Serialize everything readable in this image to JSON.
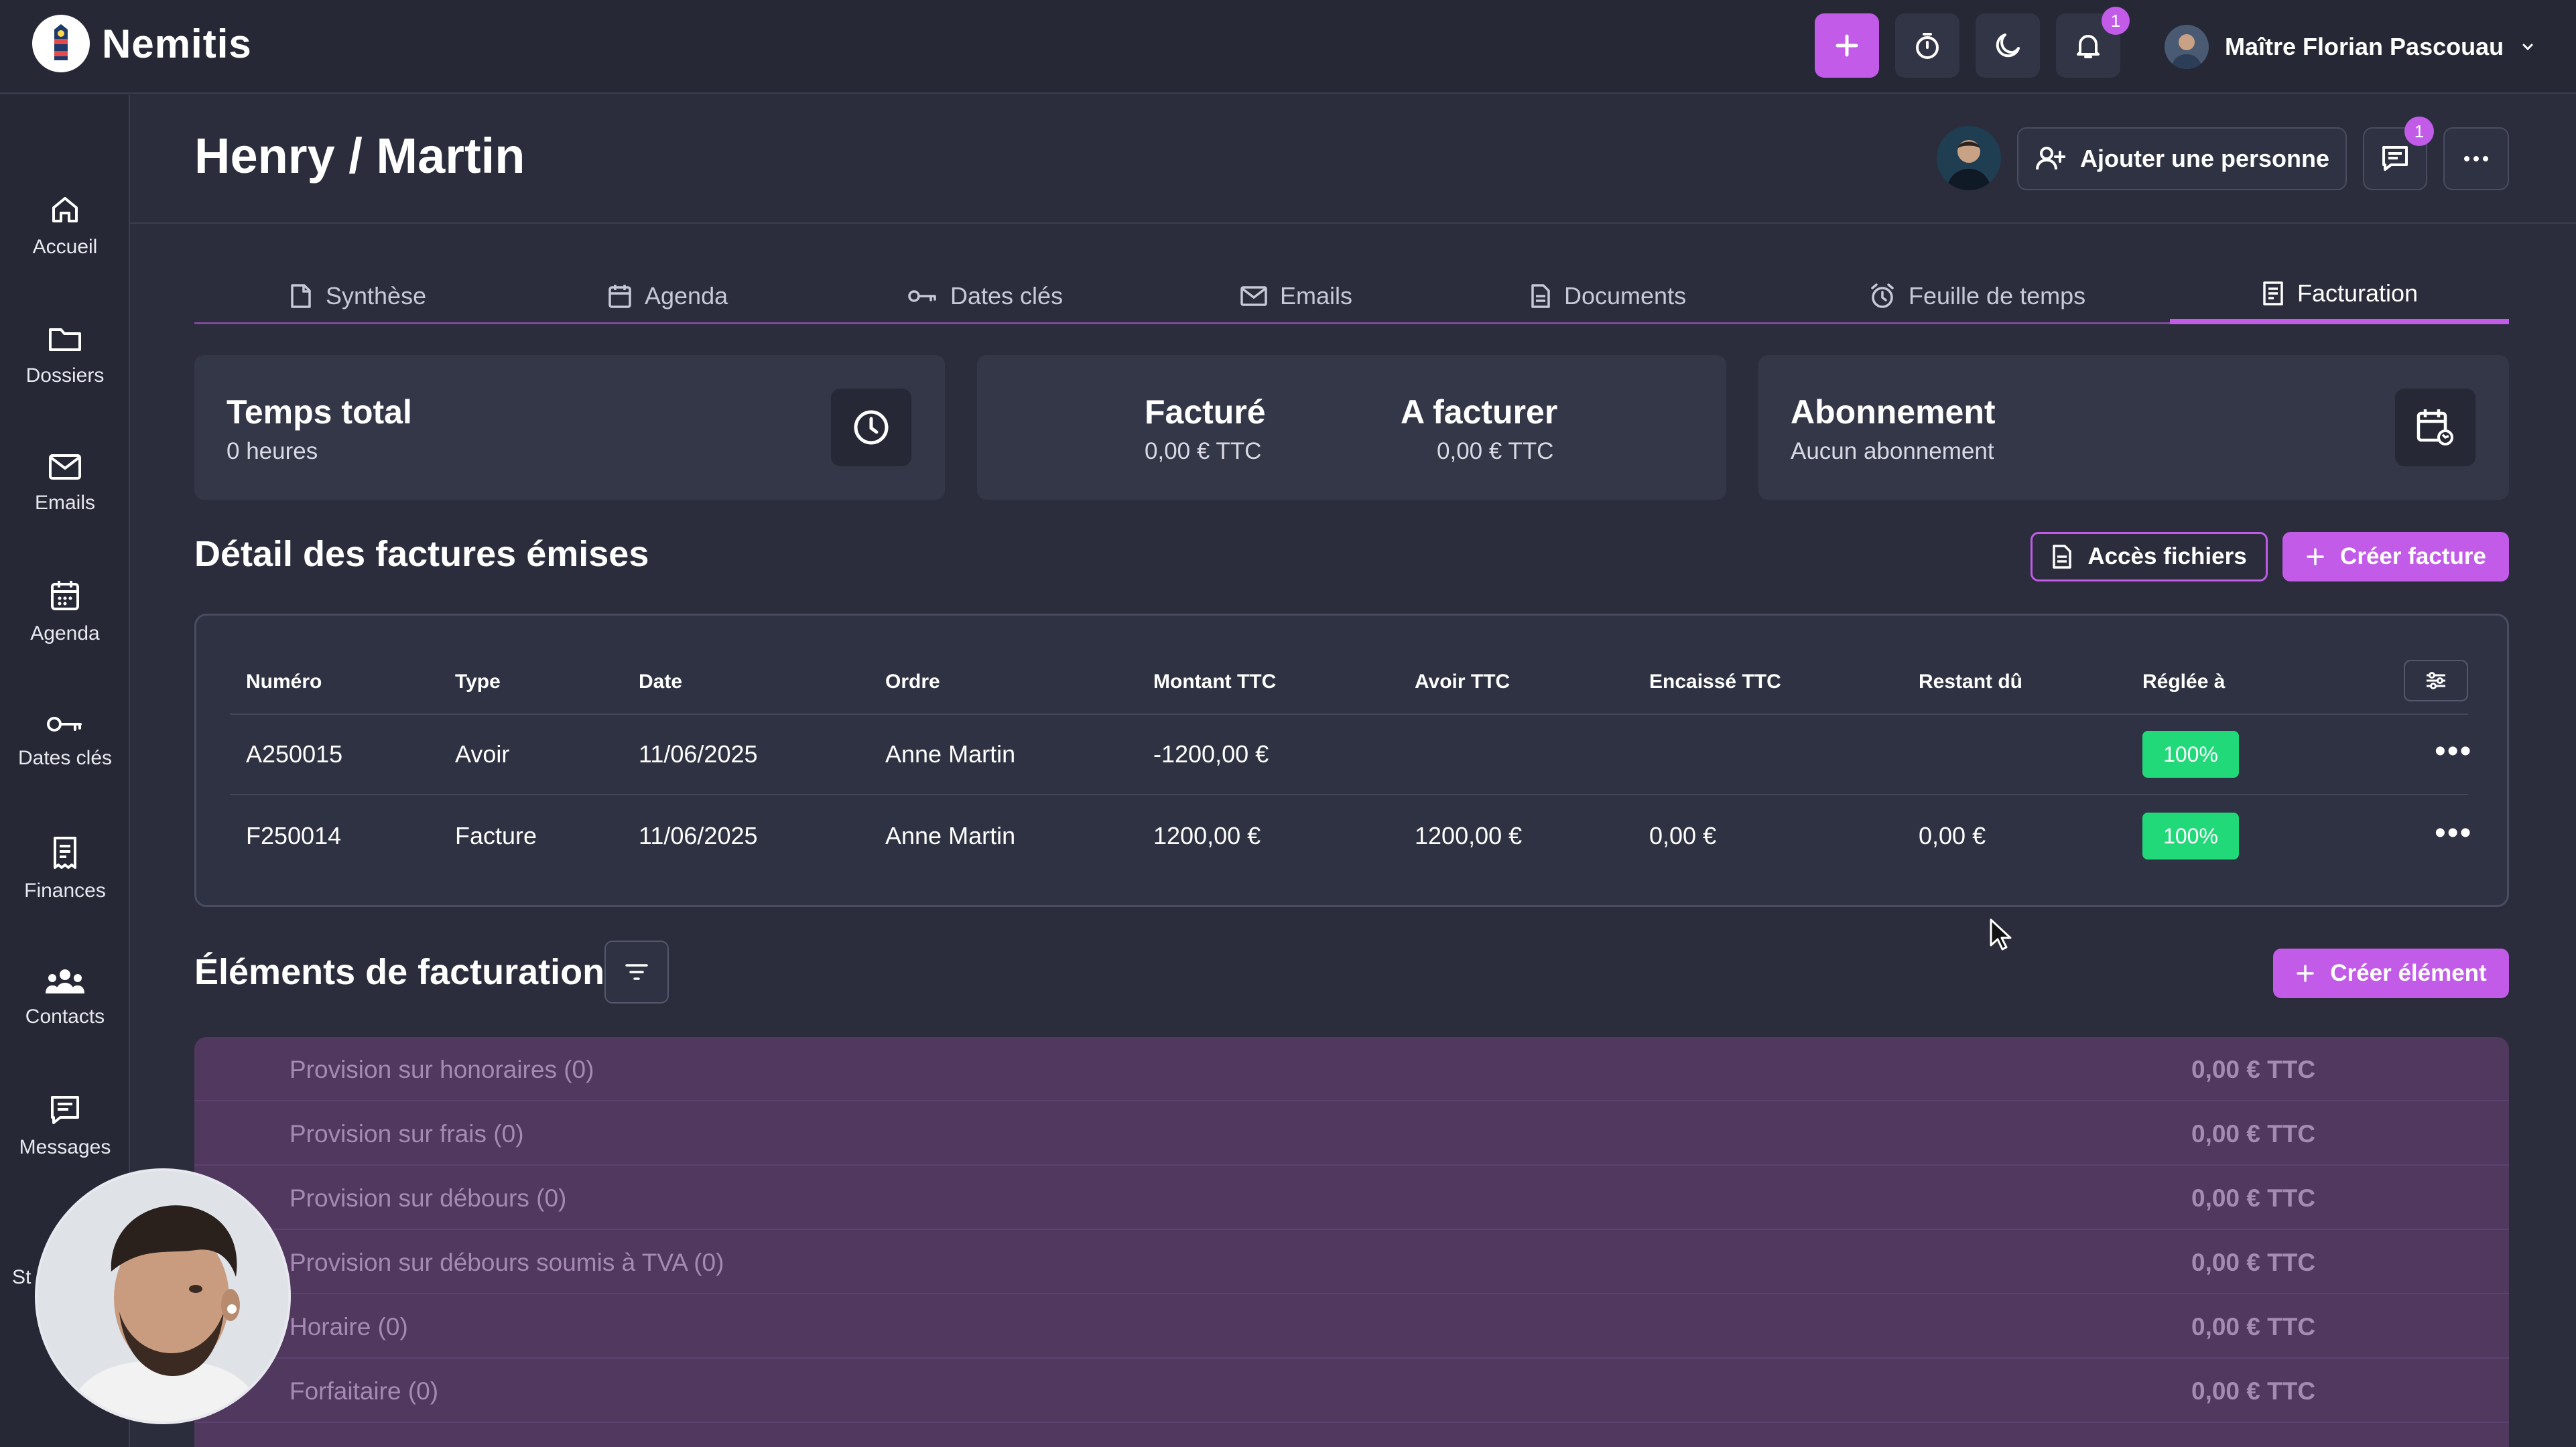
{
  "app": {
    "name": "Nemitis"
  },
  "topbar": {
    "notification_count": "1",
    "user_name": "Maître Florian Pascouau",
    "icons": [
      "plus-icon",
      "stopwatch-icon",
      "moon-icon",
      "bell-icon",
      "chevron-down-icon"
    ]
  },
  "sidebar": {
    "items": [
      {
        "label": "Accueil",
        "icon": "home-icon"
      },
      {
        "label": "Dossiers",
        "icon": "folder-icon"
      },
      {
        "label": "Emails",
        "icon": "mail-icon"
      },
      {
        "label": "Agenda",
        "icon": "calendar-icon"
      },
      {
        "label": "Dates clés",
        "icon": "key-icon"
      },
      {
        "label": "Finances",
        "icon": "receipt-icon"
      },
      {
        "label": "Contacts",
        "icon": "users-icon"
      },
      {
        "label": "Messages",
        "icon": "message-icon"
      }
    ],
    "partial_label": "St"
  },
  "header": {
    "title": "Henry / Martin",
    "add_person_label": "Ajouter une personne",
    "messages_badge": "1"
  },
  "tabs": [
    {
      "label": "Synthèse",
      "icon": "document-icon",
      "active": false
    },
    {
      "label": "Agenda",
      "icon": "calendar-icon",
      "active": false
    },
    {
      "label": "Dates clés",
      "icon": "key-icon",
      "active": false
    },
    {
      "label": "Emails",
      "icon": "mail-icon",
      "active": false
    },
    {
      "label": "Documents",
      "icon": "file-icon",
      "active": false
    },
    {
      "label": "Feuille de temps",
      "icon": "alarm-icon",
      "active": false
    },
    {
      "label": "Facturation",
      "icon": "invoice-icon",
      "active": true
    }
  ],
  "summary": {
    "time": {
      "title": "Temps total",
      "value": "0 heures"
    },
    "billed": {
      "title": "Facturé",
      "value": "0,00 € TTC"
    },
    "to_bill": {
      "title": "A facturer",
      "value": "0,00 € TTC"
    },
    "subscription": {
      "title": "Abonnement",
      "value": "Aucun abonnement"
    }
  },
  "invoices": {
    "title": "Détail des factures émises",
    "files_button": "Accès fichiers",
    "create_button": "Créer facture",
    "columns": [
      "Numéro",
      "Type",
      "Date",
      "Ordre",
      "Montant TTC",
      "Avoir TTC",
      "Encaissé TTC",
      "Restant dû",
      "Réglée à"
    ],
    "rows": [
      {
        "numero": "A250015",
        "type": "Avoir",
        "date": "11/06/2025",
        "ordre": "Anne Martin",
        "montant": "-1200,00 €",
        "avoir": "",
        "encaisse": "",
        "restant": "",
        "reglee": "100%",
        "menu": "•••"
      },
      {
        "numero": "F250014",
        "type": "Facture",
        "date": "11/06/2025",
        "ordre": "Anne Martin",
        "montant": "1200,00 €",
        "avoir": "1200,00 €",
        "encaisse": "0,00 €",
        "restant": "0,00 €",
        "reglee": "100%",
        "menu": "•••"
      }
    ]
  },
  "elements": {
    "title": "Éléments de facturation",
    "create_button": "Créer élément",
    "rows": [
      {
        "label": "Provision sur honoraires (0)",
        "amount": "0,00 € TTC"
      },
      {
        "label": "Provision sur frais (0)",
        "amount": "0,00 € TTC"
      },
      {
        "label": "Provision sur débours (0)",
        "amount": "0,00 € TTC"
      },
      {
        "label": "Provision sur débours soumis à TVA (0)",
        "amount": "0,00 € TTC"
      },
      {
        "label": "Horaire (0)",
        "amount": "0,00 € TTC"
      },
      {
        "label": "Forfaitaire (0)",
        "amount": "0,00 € TTC"
      }
    ]
  },
  "colors": {
    "accent": "#c15be8",
    "background": "#2b2d3c",
    "success": "#22d97a",
    "elements_bg": "#51385f"
  }
}
